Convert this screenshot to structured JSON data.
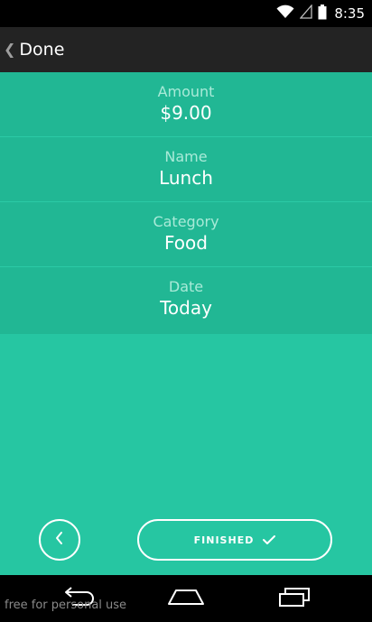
{
  "status_bar": {
    "time": "8:35",
    "icons": [
      "wifi-icon",
      "signal-icon",
      "battery-icon"
    ]
  },
  "action_bar": {
    "back_label": "Done"
  },
  "fields": [
    {
      "label": "Amount",
      "value": "$9.00"
    },
    {
      "label": "Name",
      "value": "Lunch"
    },
    {
      "label": "Category",
      "value": "Food"
    },
    {
      "label": "Date",
      "value": "Today"
    }
  ],
  "buttons": {
    "finished_label": "FINISHED"
  },
  "watermark": "free for personal use",
  "colors": {
    "background": "#26c6a2",
    "row_background": "#21b794",
    "label": "#a9ead8",
    "action_bar": "#232323"
  }
}
